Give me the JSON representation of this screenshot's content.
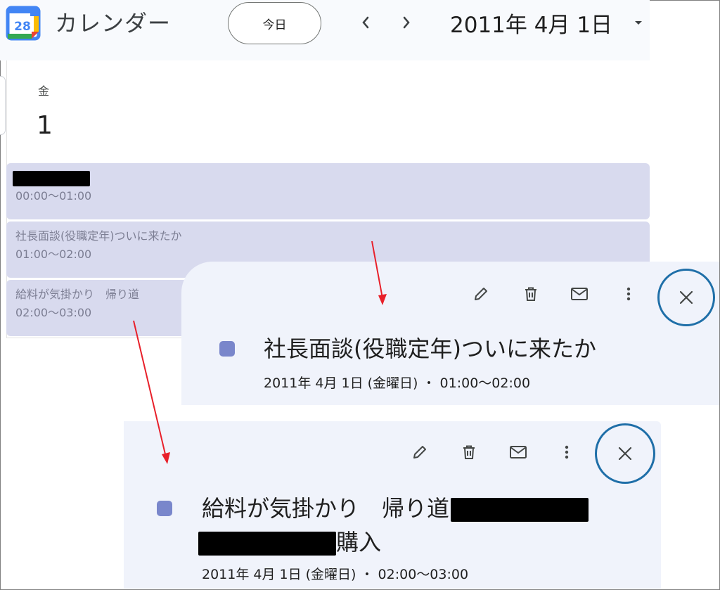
{
  "header": {
    "app_title": "カレンダー",
    "logo_day": "28",
    "today_label": "今日",
    "date_title": "2011年 4月 1日"
  },
  "day": {
    "weekday": "金",
    "number": "1"
  },
  "events": [
    {
      "title_redacted": true,
      "time": "00:00〜01:00"
    },
    {
      "title": "社長面談(役職定年)ついに来たか",
      "time": "01:00〜02:00"
    },
    {
      "title": "給料が気掛かり　帰り道",
      "time": "02:00〜03:00"
    }
  ],
  "popup1": {
    "title": "社長面談(役職定年)ついに来たか",
    "subtitle": "2011年 4月 1日 (金曜日) ・ 01:00〜02:00"
  },
  "popup2": {
    "title_line1": "給料が気掛かり　帰り道",
    "title_line2_suffix": "購入",
    "subtitle": "2011年 4月 1日 (金曜日) ・ 02:00〜03:00"
  },
  "colors": {
    "event_bg": "#d8daee",
    "swatch": "#7986cb",
    "annotation_red": "#e8202a",
    "annotation_ring": "#1f6fa8"
  }
}
